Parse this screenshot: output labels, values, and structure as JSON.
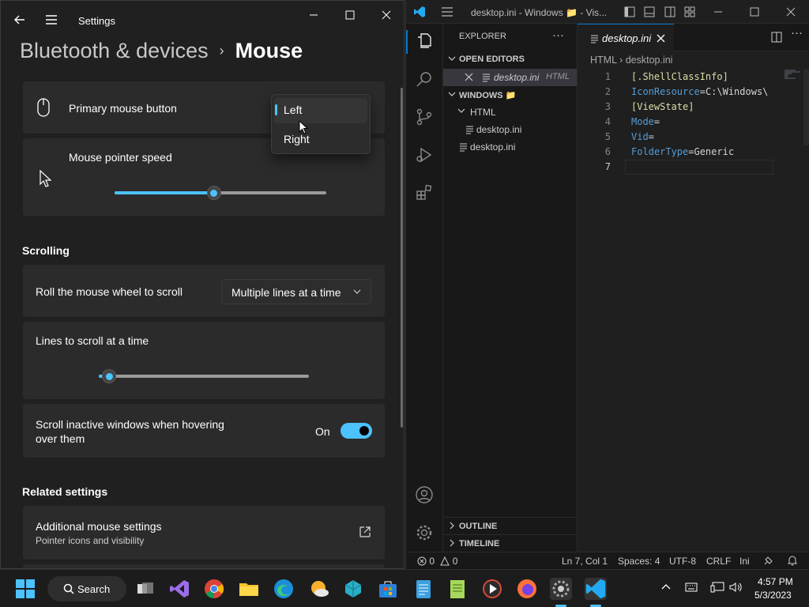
{
  "settings": {
    "window_title": "Settings",
    "breadcrumb_parent": "Bluetooth & devices",
    "breadcrumb_separator": "›",
    "page_title": "Mouse",
    "primary_button": {
      "label": "Primary mouse button",
      "options": [
        "Left",
        "Right"
      ],
      "selected": "Left"
    },
    "pointer_speed": {
      "label": "Mouse pointer speed",
      "value_fraction": 0.47
    },
    "scrolling": {
      "section_title": "Scrolling",
      "wheel_label": "Roll the mouse wheel to scroll",
      "wheel_value": "Multiple lines at a time",
      "lines_label": "Lines to scroll at a time",
      "lines_value_fraction": 0.05,
      "inactive_label_line1": "Scroll inactive windows when hovering",
      "inactive_label_line2": "over them",
      "inactive_state": "On"
    },
    "related": {
      "section_title": "Related settings",
      "additional_title": "Additional mouse settings",
      "additional_sub": "Pointer icons and visibility"
    },
    "accent_color": "#4cc2ff"
  },
  "vscode": {
    "window_title": "desktop.ini - Windows 📁 - Vis...",
    "explorer_title": "EXPLORER",
    "open_editors": "OPEN EDITORS",
    "open_file": "desktop.ini",
    "open_file_lang": "HTML",
    "folder_name": "WINDOWS 📁",
    "html_folder": "HTML",
    "html_file": "desktop.ini",
    "root_file": "desktop.ini",
    "outline": "OUTLINE",
    "timeline": "TIMELINE",
    "tab_label": "desktop.ini",
    "breadcrumb_folder": "HTML",
    "breadcrumb_file": "desktop.ini",
    "code_lines": [
      {
        "n": "1",
        "parts": [
          [
            "br",
            "[.ShellClassInfo]"
          ]
        ]
      },
      {
        "n": "2",
        "parts": [
          [
            "k",
            "IconResource"
          ],
          [
            "eq",
            "="
          ],
          [
            "eq",
            "C:\\Windows\\"
          ]
        ]
      },
      {
        "n": "3",
        "parts": [
          [
            "br",
            "[ViewState]"
          ]
        ]
      },
      {
        "n": "4",
        "parts": [
          [
            "k",
            "Mode"
          ],
          [
            "eq",
            "="
          ]
        ]
      },
      {
        "n": "5",
        "parts": [
          [
            "k",
            "Vid"
          ],
          [
            "eq",
            "="
          ]
        ]
      },
      {
        "n": "6",
        "parts": [
          [
            "k",
            "FolderType"
          ],
          [
            "eq",
            "="
          ],
          [
            "eq",
            "Generic"
          ]
        ]
      },
      {
        "n": "7",
        "parts": []
      }
    ],
    "status": {
      "errors": "0",
      "warnings": "0",
      "position": "Ln 7, Col 1",
      "spaces": "Spaces: 4",
      "encoding": "UTF-8",
      "eol": "CRLF",
      "language": "Ini"
    }
  },
  "taskbar": {
    "search_label": "Search",
    "time": "4:57 PM",
    "date": "5/3/2023"
  }
}
